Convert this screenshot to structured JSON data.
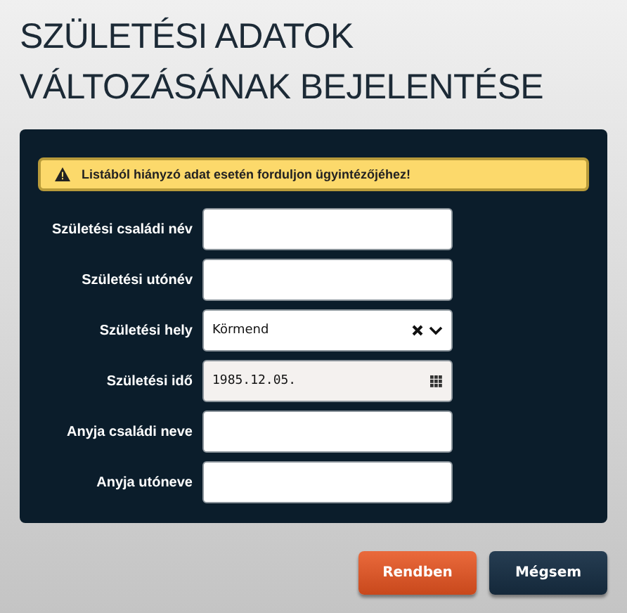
{
  "title": "SZÜLETÉSI ADATOK VÁLTOZÁSÁNAK BEJELENTÉSE",
  "warning": "Listából hiányzó adat esetén forduljon ügyintézőjéhez!",
  "fields": [
    {
      "kind": "text",
      "label": "Születési családi név"
    },
    {
      "kind": "text",
      "label": "Születési utónév"
    },
    {
      "kind": "select",
      "label": "Születési hely",
      "value": "Körmend"
    },
    {
      "kind": "date",
      "label": "Születési idő",
      "value": "1985.12.05."
    },
    {
      "kind": "text",
      "label": "Anyja családi neve"
    },
    {
      "kind": "text",
      "label": "Anyja utóneve"
    }
  ],
  "buttons": [
    {
      "kind": "primary",
      "label": "Rendben"
    },
    {
      "kind": "secondary",
      "label": "Mégsem"
    }
  ]
}
